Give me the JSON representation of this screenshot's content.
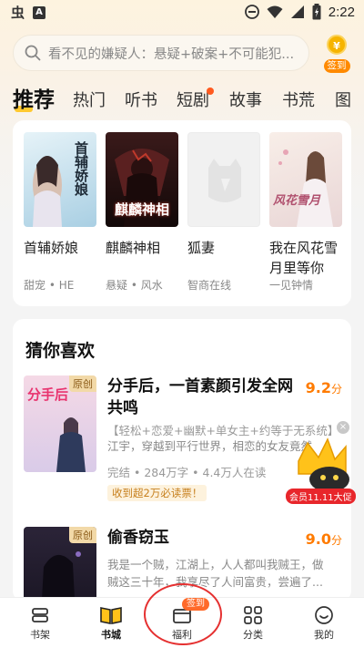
{
  "status_bar": {
    "time": "2:22",
    "app_glyph": "虫",
    "a_glyph": "A"
  },
  "search": {
    "placeholder": "看不见的嫌疑人：悬疑+破案+不可能犯...",
    "signin_coin": "¥",
    "signin_label": "签到"
  },
  "tabs": [
    {
      "label": "推荐",
      "active": true
    },
    {
      "label": "热门"
    },
    {
      "label": "听书"
    },
    {
      "label": "短剧",
      "dot": true
    },
    {
      "label": "故事"
    },
    {
      "label": "书荒"
    },
    {
      "label": "图"
    }
  ],
  "featured_books": [
    {
      "title": "首辅娇娘",
      "sub": "甜宠 • HE",
      "cover_text": "首辅娇娘",
      "cover_color": "#cfe6f2"
    },
    {
      "title": "麒麟神相",
      "sub": "悬疑 • 风水",
      "cover_text": "麒麟神相",
      "cover_color": "#2a1414"
    },
    {
      "title": "狐妻",
      "sub": "智商在线",
      "cover_text": "",
      "cover_color": "#f1f1f1"
    },
    {
      "title": "我在风花雪月里等你",
      "title_line1": "我在风花雪",
      "title_line2": "月里等你",
      "sub": "一见钟情",
      "cover_text": "风花雪月",
      "cover_color": "#f4e8e4"
    }
  ],
  "section": {
    "title": "猜你喜欢"
  },
  "recommendations": [
    {
      "title": "分手后，一首素颜引发全网共鸣",
      "score": "9.2",
      "score_unit": "分",
      "tag": "原创",
      "cover_text": "分手后",
      "tags": "【轻松+恋爱+幽默+单女主+约等于无系统】",
      "desc": "江宇，穿越到平行世界，相恋的女友竟然",
      "meta": "完结 • 284万字 • 4.4万人在读",
      "pill": "收到超2万必读票！"
    },
    {
      "title": "偷香窃玉",
      "score": "9.0",
      "score_unit": "分",
      "tag": "原创",
      "desc_line1": "我是一个贼，江湖上，人人都叫我贼王，做",
      "desc_line2": "贼这三十年，我享尽了人间富贵，尝遍了..."
    }
  ],
  "promo": {
    "label": "会员11.11大促",
    "close": "×"
  },
  "bottom_nav": [
    {
      "label": "书架"
    },
    {
      "label": "书城",
      "active": true
    },
    {
      "label": "福利",
      "badge": "签到"
    },
    {
      "label": "分类"
    },
    {
      "label": "我的"
    }
  ]
}
